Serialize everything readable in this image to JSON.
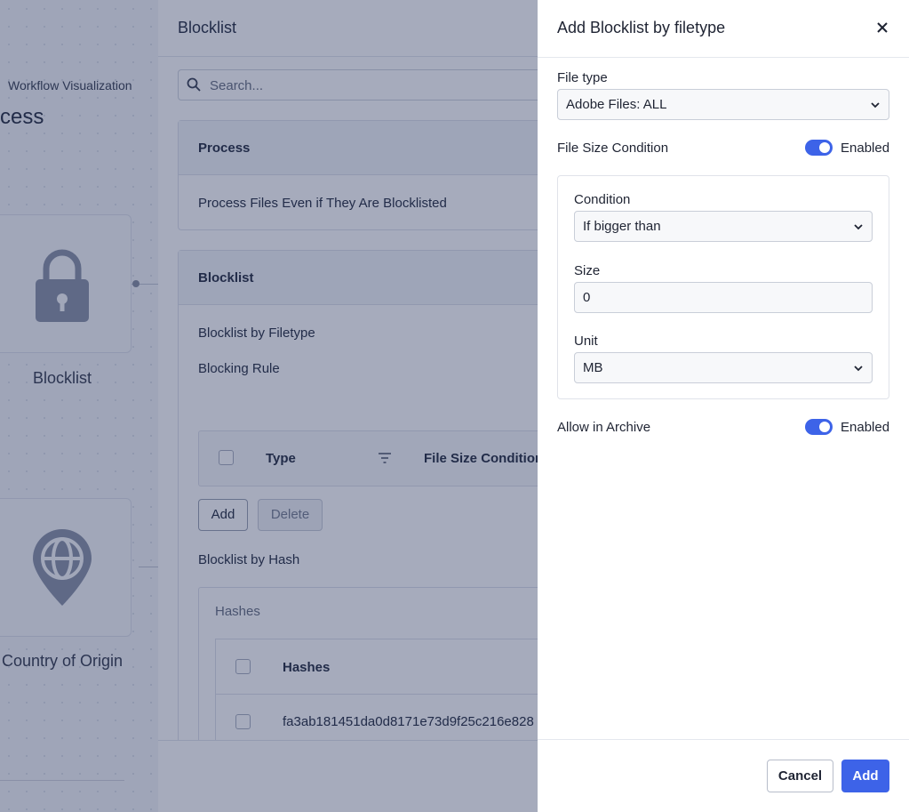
{
  "workflow": {
    "label": "Workflow Visualization",
    "title": "cess",
    "nodes": [
      {
        "label": "Blocklist",
        "icon": "lock-icon"
      },
      {
        "label": "Country of Origin",
        "icon": "globe-pin-icon"
      }
    ]
  },
  "main": {
    "title": "Blocklist",
    "search_placeholder": "Search...",
    "process_card": {
      "header": "Process",
      "item": "Process Files Even if They Are Blocklisted"
    },
    "blocklist_card": {
      "header": "Blocklist",
      "by_filetype": "Blocklist by Filetype",
      "blocking_rule": "Blocking Rule",
      "table_columns": [
        "Type",
        "File Size Condition"
      ],
      "add_label": "Add",
      "delete_label": "Delete",
      "by_hash": "Blocklist by Hash",
      "hashes_label": "Hashes",
      "hash_column": "Hashes",
      "hash_rows": [
        "fa3ab181451da0d8171e73d9f25c216e828"
      ]
    }
  },
  "drawer": {
    "title": "Add Blocklist by filetype",
    "file_type": {
      "label": "File type",
      "value": "Adobe Files: ALL"
    },
    "file_size_condition": {
      "label": "File Size Condition",
      "state": "Enabled"
    },
    "condition": {
      "label": "Condition",
      "value": "If bigger than"
    },
    "size": {
      "label": "Size",
      "value": "0"
    },
    "unit": {
      "label": "Unit",
      "value": "MB"
    },
    "allow_in_archive": {
      "label": "Allow in Archive",
      "state": "Enabled"
    },
    "cancel_label": "Cancel",
    "submit_label": "Add"
  },
  "colors": {
    "accent": "#3d63e8",
    "overlay": "#142350"
  }
}
